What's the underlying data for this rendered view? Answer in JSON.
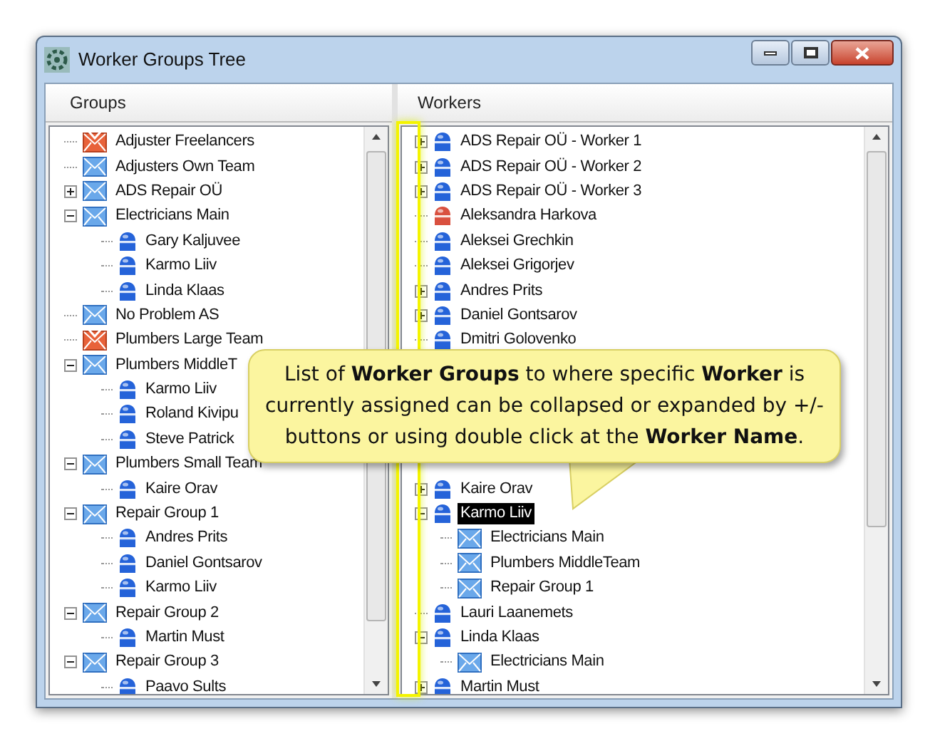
{
  "window": {
    "title": "Worker Groups Tree"
  },
  "groups_panel": {
    "header": "Groups",
    "items": [
      {
        "label": "Adjuster Freelancers",
        "kind": "group-flagged"
      },
      {
        "label": "Adjusters Own Team",
        "kind": "group"
      },
      {
        "label": "ADS Repair OÜ",
        "kind": "group",
        "expanded": false
      },
      {
        "label": "Electricians Main",
        "kind": "group",
        "expanded": true,
        "children": [
          {
            "label": "Gary Kaljuvee"
          },
          {
            "label": "Karmo Liiv"
          },
          {
            "label": "Linda Klaas"
          }
        ]
      },
      {
        "label": "No Problem AS",
        "kind": "group"
      },
      {
        "label": "Plumbers Large Team",
        "kind": "group-flagged"
      },
      {
        "label": "Plumbers MiddleT",
        "kind": "group",
        "expanded": true,
        "children": [
          {
            "label": "Karmo Liiv"
          },
          {
            "label": "Roland Kivipu"
          },
          {
            "label": "Steve Patrick"
          }
        ]
      },
      {
        "label": "Plumbers Small Team",
        "kind": "group",
        "expanded": true,
        "children": [
          {
            "label": "Kaire Orav"
          }
        ]
      },
      {
        "label": "Repair Group 1",
        "kind": "group",
        "expanded": true,
        "children": [
          {
            "label": "Andres Prits"
          },
          {
            "label": "Daniel Gontsarov"
          },
          {
            "label": "Karmo Liiv"
          }
        ]
      },
      {
        "label": "Repair Group 2",
        "kind": "group",
        "expanded": true,
        "children": [
          {
            "label": "Martin Must"
          }
        ]
      },
      {
        "label": "Repair Group 3",
        "kind": "group",
        "expanded": true,
        "children": [
          {
            "label": "Paavo Sults"
          }
        ]
      }
    ]
  },
  "workers_panel": {
    "header": "Workers",
    "items": [
      {
        "label": "ADS Repair OÜ - Worker 1",
        "color": "#2563d9",
        "expanded": false,
        "selected": false
      },
      {
        "label": "ADS Repair OÜ - Worker 2",
        "color": "#2563d9",
        "expanded": false,
        "selected": false
      },
      {
        "label": "ADS Repair OÜ - Worker 3",
        "color": "#2563d9",
        "expanded": false,
        "selected": false
      },
      {
        "label": "Aleksandra Harkova",
        "color": "#d9503f",
        "selected": false
      },
      {
        "label": "Aleksei Grechkin",
        "color": "#2563d9",
        "selected": false
      },
      {
        "label": "Aleksei Grigorjev",
        "color": "#2563d9",
        "selected": false
      },
      {
        "label": "Andres Prits",
        "color": "#2563d9",
        "expanded": false,
        "selected": false
      },
      {
        "label": "Daniel Gontsarov",
        "color": "#2563d9",
        "expanded": false,
        "selected": false
      },
      {
        "label": "Dmitri Golovenko",
        "color": "#2563d9",
        "selected": false
      },
      {
        "label": "Kaire Orav",
        "color": "#2563d9",
        "expanded": false,
        "selected": false
      },
      {
        "label": "Karmo Liiv",
        "color": "#2563d9",
        "expanded": true,
        "selected": true,
        "children": [
          {
            "label": "Electricians Main"
          },
          {
            "label": "Plumbers MiddleTeam"
          },
          {
            "label": "Repair Group 1"
          }
        ]
      },
      {
        "label": "Lauri Laanemets",
        "color": "#2563d9",
        "selected": false
      },
      {
        "label": "Linda Klaas",
        "color": "#2563d9",
        "expanded": true,
        "selected": false,
        "children": [
          {
            "label": "Electricians Main"
          }
        ]
      },
      {
        "label": "Martin Must",
        "color": "#2563d9",
        "expanded": false,
        "selected": false
      }
    ]
  },
  "callout": {
    "text": "List of **Worker Groups** to where specific **Worker** is currently assigned can be collapsed or expanded by +/- buttons or using double click at the **Worker Name**."
  }
}
